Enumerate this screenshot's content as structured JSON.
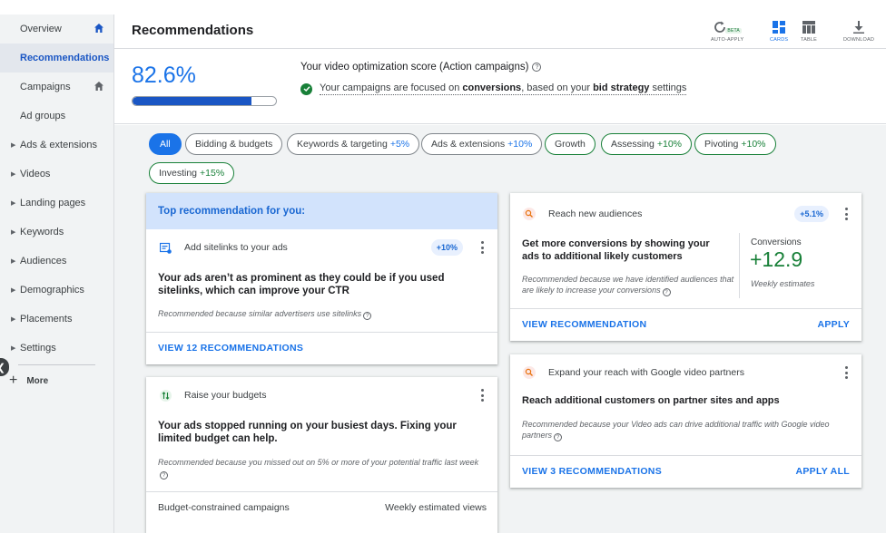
{
  "sidebar": {
    "items": [
      {
        "label": "Overview"
      },
      {
        "label": "Recommendations"
      },
      {
        "label": "Campaigns"
      },
      {
        "label": "Ad groups"
      },
      {
        "label": "Ads & extensions"
      },
      {
        "label": "Videos"
      },
      {
        "label": "Landing pages"
      },
      {
        "label": "Keywords"
      },
      {
        "label": "Audiences"
      },
      {
        "label": "Demographics"
      },
      {
        "label": "Placements"
      },
      {
        "label": "Settings"
      }
    ],
    "more_label": "More",
    "active_index": 1
  },
  "header": {
    "title": "Recommendations",
    "tools": {
      "auto_apply": "AUTO-APPLY",
      "beta": "BETA",
      "cards": "CARDS",
      "table": "TABLE",
      "download": "DOWNLOAD"
    }
  },
  "score": {
    "value": "82.6%",
    "fraction": 0.826,
    "title": "Your video optimization score (Action campaigns)",
    "status_prefix": "Your campaigns are focused on ",
    "status_bold1": "conversions",
    "status_mid": ", based on your ",
    "status_bold2": "bid strategy",
    "status_suffix": " settings"
  },
  "filters": {
    "all": "All",
    "bidding": "Bidding & budgets",
    "keywords": "Keywords & targeting",
    "keywords_pct": "+5%",
    "ads": "Ads & extensions",
    "ads_pct": "+10%",
    "growth": "Growth",
    "assessing": "Assessing",
    "assessing_pct": "+10%",
    "pivoting": "Pivoting",
    "pivoting_pct": "+10%",
    "investing": "Investing",
    "investing_pct": "+15%"
  },
  "top_card": {
    "banner": "Top recommendation for you:",
    "title": "Add sitelinks to your ads",
    "badge": "+10%",
    "text": "Your ads aren’t as prominent as they could be if you used sitelinks, which can improve your CTR",
    "note": "Recommended because similar advertisers use sitelinks",
    "link": "VIEW 12 RECOMMENDATIONS"
  },
  "budget_card": {
    "title": "Raise your budgets",
    "text": "Your ads stopped running on your busiest days. Fixing your limited budget can help.",
    "note": "Recommended because you missed out on 5% or more of your potential traffic last week",
    "col1": "Budget-constrained campaigns",
    "col2": "Weekly estimated views"
  },
  "audience_card": {
    "title": "Reach new audiences",
    "badge": "+5.1%",
    "text": "Get more conversions by showing your ads to additional likely customers",
    "note": "Recommended because we have identified audiences that are likely to increase your conversions",
    "metric_label": "Conversions",
    "metric_value": "+12.9",
    "metric_sub": "Weekly estimates",
    "link": "VIEW RECOMMENDATION",
    "apply": "APPLY"
  },
  "partners_card": {
    "title": "Expand your reach with Google video partners",
    "text": "Reach additional customers on partner sites and apps",
    "note": "Recommended because your Video ads can drive additional traffic with Google video partners",
    "link": "VIEW 3 RECOMMENDATIONS",
    "apply": "APPLY ALL"
  },
  "colors": {
    "accent": "#1a73e8",
    "success": "#188038",
    "banner": "#d2e3fc"
  }
}
